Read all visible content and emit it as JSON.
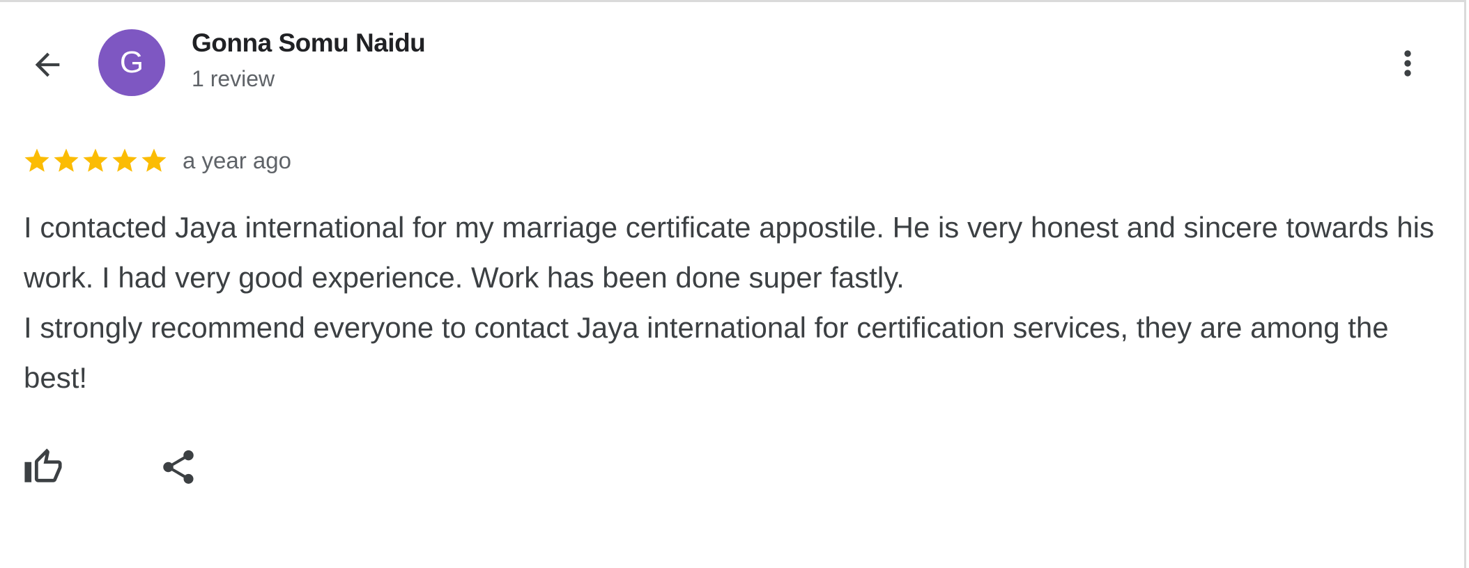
{
  "reviewer": {
    "name": "Gonna Somu Naidu",
    "review_count": "1 review",
    "avatar_initial": "G",
    "avatar_color": "#7e57c2"
  },
  "review": {
    "rating": 5,
    "max_rating": 5,
    "star_color": "#fbbc04",
    "date": "a year ago",
    "text_paragraphs": [
      "I contacted Jaya international for my marriage certificate appostile. He is very honest and sincere towards his work. I had very good experience. Work has been done super fastly.",
      "I strongly recommend everyone to contact Jaya international for certification services, they are among the best!"
    ]
  },
  "icons": {
    "back": "arrow-back-icon",
    "more": "more-vert-icon",
    "star": "star-icon",
    "like": "thumb-up-icon",
    "share": "share-icon"
  },
  "colors": {
    "text_primary": "#202124",
    "text_secondary": "#5f6368",
    "text_body": "#3c4043",
    "icon": "#3c4043"
  }
}
